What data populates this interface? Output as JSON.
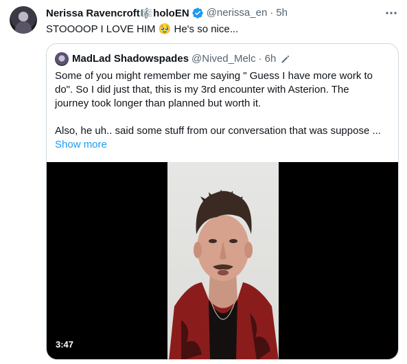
{
  "tweet": {
    "author_name": "Nerissa Ravencroft",
    "author_name_emoji": "🎼",
    "author_name_suffix": "holoEN",
    "verified_icon": "verified-badge-icon",
    "handle": "@nerissa_en",
    "separator": "·",
    "time": "5h",
    "text": "STOOOOP I LOVE HIM 🥹 He's so nice...",
    "more_icon": "more-options-icon"
  },
  "quote": {
    "author_name": "MadLad Shadowspades",
    "handle": "@Nived_Melc",
    "separator": "·",
    "time": "6h",
    "edited_icon": "edited-pencil-icon",
    "lines": [
      "Some of you might remember me saying \" Guess I have more work to",
      "do\". So I did just that, this is my 3rd encounter with Asterion. The",
      "journey took longer than planned but worth it.",
      "Also, he uh.. said some stuff from our conversation that was suppose ..."
    ],
    "show_more_label": "Show more",
    "video": {
      "duration": "3:47"
    }
  },
  "colors": {
    "text": "#0f1419",
    "secondary": "#536471",
    "link": "#1d9bf0",
    "border": "#cfd9de",
    "verified": "#1d9bf0"
  }
}
